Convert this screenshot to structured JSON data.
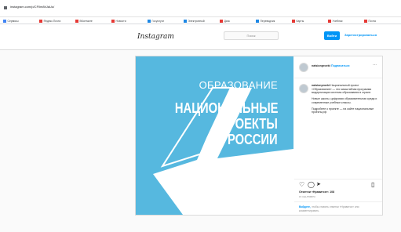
{
  "browser": {
    "url": "instagram.com/p/CFIlm8hJaUu/",
    "bookmarks": [
      {
        "label": "Сервисы",
        "color": "#4285f4"
      },
      {
        "label": "Яндекс.Почта",
        "color": "#e53935"
      },
      {
        "label": "ВКонтакте",
        "color": "#e53935"
      },
      {
        "label": "Новости",
        "color": "#e53935"
      },
      {
        "label": "Госуслуги",
        "color": "#1e88e5"
      },
      {
        "label": "Электронный",
        "color": "#1e88e5"
      },
      {
        "label": "Диск",
        "color": "#e53935"
      },
      {
        "label": "Переводчик",
        "color": "#1e88e5"
      },
      {
        "label": "Карты",
        "color": "#e53935"
      },
      {
        "label": "Учебник",
        "color": "#e53935"
      },
      {
        "label": "Почта",
        "color": "#e53935"
      }
    ]
  },
  "instagram": {
    "logo": "Instagram",
    "search_placeholder": "Поиск",
    "login_label": "Войти",
    "signup_label": "Зарегистрироваться"
  },
  "post": {
    "image": {
      "title": "ОБРАЗОВАНИЕ",
      "lines": [
        "НАЦИОНАЛЬНЫЕ",
        "ПРОЕКТЫ",
        "РОССИИ"
      ],
      "bg_color": "#56b8df"
    },
    "author": "natsionproekt",
    "subscribe_label": "Подписаться",
    "caption_paragraphs": [
      "Национальный проект «Образование» — это масштабная программа модернизации системы образования в стране.",
      "Новые школы, цифровая образовательная среда и современные учебные классы.",
      "Подробнее о проекте — на сайте национальные проекты.рф"
    ],
    "likes": "Отметки «Нравится»: 108",
    "date": "15 СЕНТЯБРЯ",
    "login_note": {
      "link": "Войдите,",
      "text": "чтобы ставить отметки «Нравится» или комментировать."
    }
  }
}
